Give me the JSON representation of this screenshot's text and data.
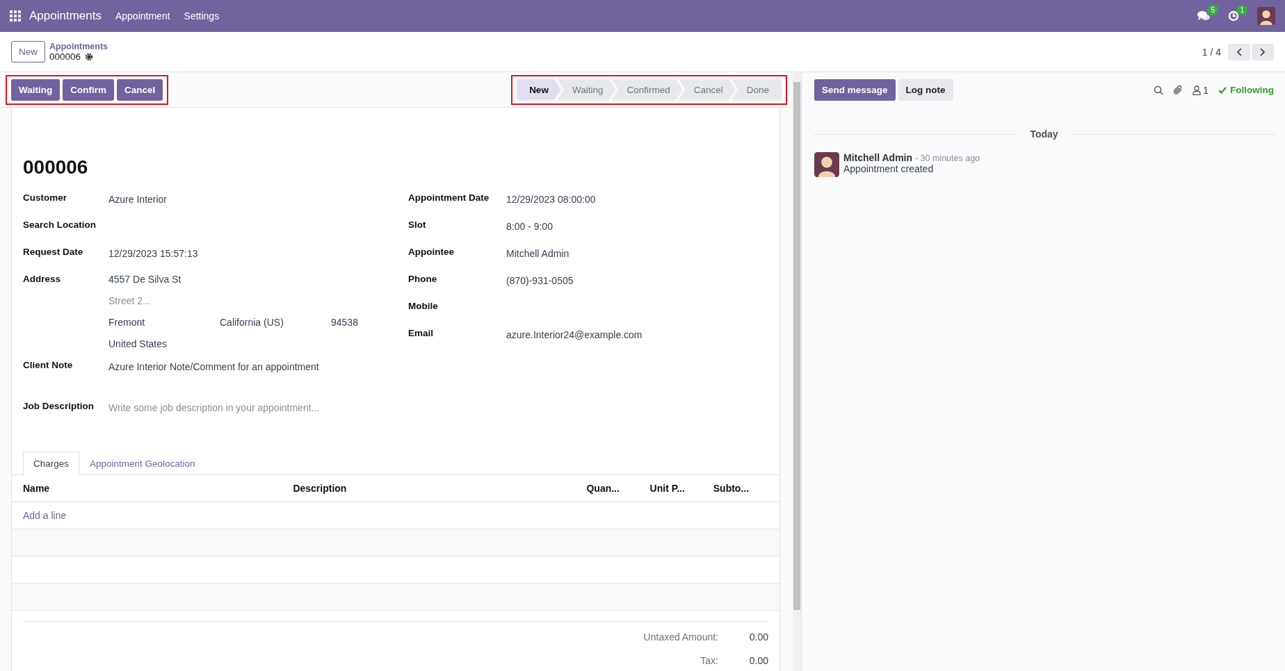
{
  "navbar": {
    "app_name": "Appointments",
    "menus": [
      "Appointment",
      "Settings"
    ],
    "messages_badge": "5",
    "activities_badge": "1"
  },
  "control_panel": {
    "new_button": "New",
    "breadcrumb": "Appointments",
    "record": "000006",
    "pager": "1 / 4"
  },
  "action_buttons": [
    "Waiting",
    "Confirm",
    "Cancel"
  ],
  "stages": [
    {
      "label": "New",
      "selected": true
    },
    {
      "label": "Waiting",
      "selected": false
    },
    {
      "label": "Confirmed",
      "selected": false
    },
    {
      "label": "Cancel",
      "selected": false
    },
    {
      "label": "Done",
      "selected": false
    }
  ],
  "form": {
    "title": "000006",
    "left_fields": [
      {
        "kind": "text",
        "label": "Customer",
        "value": "Azure Interior"
      },
      {
        "kind": "text",
        "label": "Search Location"
      },
      {
        "kind": "text",
        "label": "Request Date",
        "value": "12/29/2023 15:57:13"
      },
      {
        "kind": "address",
        "label": "Address",
        "street": "4557 De Silva St",
        "street2_placeholder": "Street 2...",
        "city": "Fremont",
        "state": "California (US)",
        "zip": "94538",
        "country": "United States"
      }
    ],
    "right_fields": [
      {
        "label": "Appointment Date",
        "value": "12/29/2023 08:00:00"
      },
      {
        "label": "Slot",
        "value": "8:00 - 9:00"
      },
      {
        "label": "Appointee",
        "value": "Mitchell Admin"
      },
      {
        "label": "Phone",
        "value": "(870)-931-0505"
      },
      {
        "label": "Mobile"
      },
      {
        "label": "Email",
        "value": "azure.Interior24@example.com"
      }
    ],
    "client_note": {
      "label": "Client Note",
      "value": "Azure Interior Note/Comment for an appointment"
    },
    "job_description": {
      "label": "Job Description",
      "placeholder": "Write some job description in your appointment..."
    }
  },
  "tabs": [
    {
      "label": "Charges",
      "selected": true
    },
    {
      "label": "Appointment Geolocation",
      "selected": false
    }
  ],
  "table": {
    "columns": [
      "Name",
      "Description",
      "Quan...",
      "Unit P...",
      "Subto..."
    ],
    "add_line": "Add a line"
  },
  "totals": [
    {
      "label": "Untaxed Amount:",
      "value": "0.00"
    },
    {
      "label": "Tax:",
      "value": "0.00"
    }
  ],
  "chatter": {
    "send_message": "Send message",
    "log_note": "Log note",
    "followers_count": "1",
    "following": "Following",
    "date_separator": "Today",
    "messages": [
      {
        "author": "Mitchell Admin",
        "time": "- 30 minutes ago",
        "body": "Appointment created"
      }
    ]
  }
}
